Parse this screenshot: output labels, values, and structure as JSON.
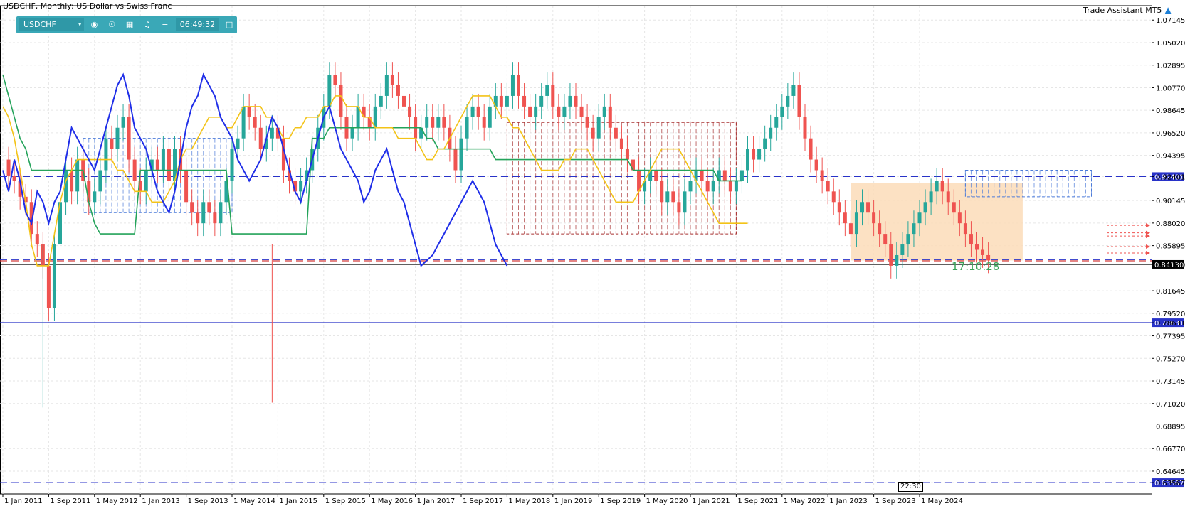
{
  "window": {
    "title": "USDCHF, Monthly:  US Dollar vs Swiss Franc",
    "assistant_label": "Trade Assistant MT5",
    "timer": "17:10:28",
    "crosshair_time": "22:30"
  },
  "toolbar": {
    "symbol": "USDCHF",
    "time": "06:49:32"
  },
  "icons": {
    "dropdown": "chevron-down-icon",
    "camera": "camera-icon",
    "eye": "eye-icon",
    "calendar": "calendar-icon",
    "bell": "bell-icon",
    "menu": "menu-icon",
    "window": "window-icon",
    "assistant": "graduation-cap-icon"
  },
  "colors": {
    "bull": "#26a69a",
    "bear": "#ef5350",
    "tenkan": "#f3c317",
    "kijun": "#24a35a",
    "chikou": "#1f2ee8",
    "kumo_bull": "#4c7bd9",
    "kumo_bear": "#a83232",
    "box": "#fcdcb8",
    "grid": "#e6e6e6"
  },
  "chart_data": {
    "type": "candlestick",
    "symbol": "USDCHF",
    "timeframe": "Monthly",
    "ylim": [
      0.625,
      1.085
    ],
    "y_ticks": [
      "1.07145",
      "1.05020",
      "1.02895",
      "1.00770",
      "0.98645",
      "0.96520",
      "0.94395",
      "0.92401",
      "0.90145",
      "0.88020",
      "0.85895",
      "0.84130",
      "0.81645",
      "0.79520",
      "0.78631",
      "0.77395",
      "0.75270",
      "0.73145",
      "0.71020",
      "0.68895",
      "0.66770",
      "0.64645",
      "0.63567"
    ],
    "y_tick_values": [
      1.07145,
      1.0502,
      1.02895,
      1.0077,
      0.98645,
      0.9652,
      0.94395,
      0.92401,
      0.90145,
      0.8802,
      0.85895,
      0.8413,
      0.81645,
      0.7952,
      0.78631,
      0.77395,
      0.7527,
      0.73145,
      0.7102,
      0.68895,
      0.6677,
      0.64645,
      0.63567
    ],
    "x_labels": [
      "1 Jan 2011",
      "1 Sep 2011",
      "1 May 2012",
      "1 Jan 2013",
      "1 Sep 2013",
      "1 May 2014",
      "1 Jan 2015",
      "1 Sep 2015",
      "1 May 2016",
      "1 Jan 2017",
      "1 Sep 2017",
      "1 May 2018",
      "1 Jan 2019",
      "1 Sep 2019",
      "1 May 2020",
      "1 Jan 2021",
      "1 Sep 2021",
      "1 May 2022",
      "1 Jan 2023",
      "1 Sep 2023",
      "1 May 2024"
    ],
    "x_label_months": [
      0,
      8,
      16,
      24,
      32,
      40,
      48,
      56,
      64,
      72,
      80,
      88,
      96,
      104,
      112,
      120,
      128,
      136,
      144,
      152,
      160
    ],
    "total_months": 200,
    "close_series": [
      0.94,
      0.925,
      0.92,
      0.905,
      0.9,
      0.87,
      0.86,
      0.84,
      0.8,
      0.86,
      0.9,
      0.93,
      0.91,
      0.94,
      0.92,
      0.9,
      0.91,
      0.93,
      0.96,
      0.95,
      0.97,
      0.98,
      0.94,
      0.92,
      0.91,
      0.93,
      0.94,
      0.93,
      0.95,
      0.92,
      0.95,
      0.93,
      0.9,
      0.89,
      0.88,
      0.9,
      0.89,
      0.88,
      0.9,
      0.92,
      0.95,
      0.96,
      0.99,
      0.98,
      0.97,
      0.95,
      0.96,
      0.97,
      0.96,
      0.93,
      0.92,
      0.91,
      0.92,
      0.93,
      0.95,
      0.97,
      0.99,
      1.02,
      1.01,
      0.98,
      0.96,
      0.97,
      0.99,
      0.98,
      0.97,
      0.99,
      1.0,
      1.02,
      1.01,
      1.0,
      0.99,
      0.98,
      0.96,
      0.97,
      0.98,
      0.97,
      0.98,
      0.97,
      0.95,
      0.93,
      0.96,
      0.98,
      0.99,
      0.98,
      0.97,
      0.99,
      1.0,
      0.99,
      1.0,
      1.02,
      1.0,
      0.99,
      0.98,
      0.99,
      1.0,
      1.01,
      0.99,
      0.98,
      0.99,
      1.0,
      0.99,
      0.98,
      0.97,
      0.96,
      0.98,
      0.99,
      0.97,
      0.96,
      0.95,
      0.94,
      0.93,
      0.91,
      0.92,
      0.93,
      0.92,
      0.9,
      0.91,
      0.9,
      0.89,
      0.91,
      0.92,
      0.93,
      0.92,
      0.91,
      0.92,
      0.93,
      0.92,
      0.91,
      0.92,
      0.93,
      0.95,
      0.94,
      0.95,
      0.96,
      0.97,
      0.98,
      0.99,
      1.0,
      1.01,
      0.98,
      0.96,
      0.94,
      0.93,
      0.92,
      0.91,
      0.9,
      0.89,
      0.88,
      0.87,
      0.89,
      0.9,
      0.89,
      0.88,
      0.87,
      0.86,
      0.84,
      0.85,
      0.86,
      0.87,
      0.88,
      0.89,
      0.9,
      0.91,
      0.92,
      0.91,
      0.9,
      0.89,
      0.88,
      0.87,
      0.86,
      0.855,
      0.85,
      0.845
    ],
    "lows_highlighted": [
      {
        "month": 7,
        "value": 0.7064
      },
      {
        "month": 47,
        "value": 0.711
      }
    ],
    "tenkan": [
      0.99,
      0.98,
      0.96,
      0.93,
      0.9,
      0.86,
      0.84,
      0.84,
      0.84,
      0.87,
      0.9,
      0.92,
      0.93,
      0.94,
      0.94,
      0.94,
      0.94,
      0.94,
      0.94,
      0.94,
      0.93,
      0.93,
      0.92,
      0.91,
      0.91,
      0.91,
      0.9,
      0.9,
      0.9,
      0.91,
      0.92,
      0.94,
      0.95,
      0.95,
      0.96,
      0.97,
      0.98,
      0.98,
      0.98,
      0.97,
      0.97,
      0.98,
      0.99,
      0.99,
      0.99,
      0.99,
      0.98,
      0.98,
      0.97,
      0.96,
      0.96,
      0.97,
      0.97,
      0.98,
      0.98,
      0.98,
      0.99,
      0.99,
      1.0,
      1.0,
      0.99,
      0.99,
      0.99,
      0.98,
      0.98,
      0.97,
      0.97,
      0.97,
      0.97,
      0.96,
      0.96,
      0.96,
      0.96,
      0.95,
      0.94,
      0.94,
      0.95,
      0.95,
      0.96,
      0.97,
      0.98,
      0.99,
      1.0,
      1.0,
      1.0,
      1.0,
      0.99,
      0.98,
      0.98,
      0.97,
      0.97,
      0.96,
      0.95,
      0.94,
      0.93,
      0.93,
      0.93,
      0.93,
      0.94,
      0.94,
      0.95,
      0.95,
      0.95,
      0.94,
      0.93,
      0.92,
      0.91,
      0.9,
      0.9,
      0.9,
      0.9,
      0.91,
      0.92,
      0.93,
      0.94,
      0.95,
      0.95,
      0.95,
      0.95,
      0.94,
      0.93,
      0.92,
      0.91,
      0.9,
      0.89,
      0.88,
      0.88,
      0.88,
      0.88,
      0.88,
      0.88
    ],
    "kijun": [
      1.02,
      1.0,
      0.98,
      0.96,
      0.95,
      0.93,
      0.93,
      0.93,
      0.93,
      0.93,
      0.93,
      0.93,
      0.93,
      0.93,
      0.93,
      0.9,
      0.88,
      0.87,
      0.87,
      0.87,
      0.87,
      0.87,
      0.87,
      0.87,
      0.93,
      0.93,
      0.93,
      0.93,
      0.93,
      0.93,
      0.93,
      0.93,
      0.93,
      0.93,
      0.93,
      0.93,
      0.93,
      0.93,
      0.93,
      0.93,
      0.87,
      0.87,
      0.87,
      0.87,
      0.87,
      0.87,
      0.87,
      0.87,
      0.87,
      0.87,
      0.87,
      0.87,
      0.87,
      0.87,
      0.96,
      0.96,
      0.96,
      0.97,
      0.97,
      0.97,
      0.97,
      0.97,
      0.97,
      0.97,
      0.97,
      0.97,
      0.97,
      0.97,
      0.97,
      0.97,
      0.97,
      0.97,
      0.97,
      0.97,
      0.96,
      0.96,
      0.95,
      0.95,
      0.95,
      0.95,
      0.95,
      0.95,
      0.95,
      0.95,
      0.95,
      0.95,
      0.94,
      0.94,
      0.94,
      0.94,
      0.94,
      0.94,
      0.94,
      0.94,
      0.94,
      0.94,
      0.94,
      0.94,
      0.94,
      0.94,
      0.94,
      0.94,
      0.94,
      0.94,
      0.94,
      0.94,
      0.94,
      0.94,
      0.94,
      0.94,
      0.93,
      0.93,
      0.93,
      0.93,
      0.93,
      0.93,
      0.93,
      0.93,
      0.93,
      0.93,
      0.93,
      0.93,
      0.93,
      0.93,
      0.93,
      0.92,
      0.92,
      0.92,
      0.92,
      0.92
    ],
    "chikou": [
      0.93,
      0.91,
      0.94,
      0.92,
      0.89,
      0.88,
      0.91,
      0.9,
      0.88,
      0.9,
      0.91,
      0.94,
      0.97,
      0.96,
      0.95,
      0.94,
      0.93,
      0.95,
      0.97,
      0.99,
      1.01,
      1.02,
      1.0,
      0.97,
      0.96,
      0.95,
      0.93,
      0.91,
      0.9,
      0.89,
      0.91,
      0.94,
      0.97,
      0.99,
      1.0,
      1.02,
      1.01,
      1.0,
      0.98,
      0.97,
      0.96,
      0.94,
      0.93,
      0.92,
      0.93,
      0.94,
      0.96,
      0.98,
      0.97,
      0.95,
      0.93,
      0.91,
      0.9,
      0.92,
      0.94,
      0.96,
      0.98,
      0.99,
      0.97,
      0.95,
      0.94,
      0.93,
      0.92,
      0.9,
      0.91,
      0.93,
      0.94,
      0.95,
      0.93,
      0.91,
      0.9,
      0.88,
      0.86,
      0.84,
      0.845,
      0.85,
      0.86,
      0.87,
      0.88,
      0.89,
      0.9,
      0.91,
      0.92,
      0.91,
      0.9,
      0.88,
      0.86,
      0.85,
      0.84
    ],
    "kumo_bull_box": {
      "from_month": 14,
      "to_month": 40,
      "top": 0.96,
      "bottom": 0.89
    },
    "kumo_bear_box": {
      "from_month": 88,
      "to_month": 128,
      "top": 0.975,
      "bottom": 0.87
    },
    "future_kumo_box": {
      "from_month": 168,
      "to_month": 190,
      "top": 0.93,
      "bottom": 0.905
    },
    "highlight_box": {
      "from_month": 148,
      "to_month": 178,
      "top": 0.918,
      "bottom": 0.845
    },
    "horizontal_lines": [
      {
        "price": 0.92401,
        "style": "dashed",
        "color": "#2832c8",
        "label": "0.92401"
      },
      {
        "price": 0.8413,
        "style": "solid",
        "color": "#000000",
        "label": "0.84130"
      },
      {
        "price": 0.78631,
        "style": "solid",
        "color": "#2832c8",
        "label": "0.78631"
      },
      {
        "price": 0.63567,
        "style": "dashed",
        "color": "#2832c8",
        "label": "0.63567"
      },
      {
        "price": 0.8446,
        "style": "dashed",
        "color": "#d23c3c",
        "label": ""
      },
      {
        "price": 0.8458,
        "style": "dashed",
        "color": "#2832c8",
        "label": ""
      }
    ],
    "arrow_markers": [
      0.878,
      0.871,
      0.868,
      0.858,
      0.852
    ],
    "grid": true,
    "legend": "none"
  }
}
